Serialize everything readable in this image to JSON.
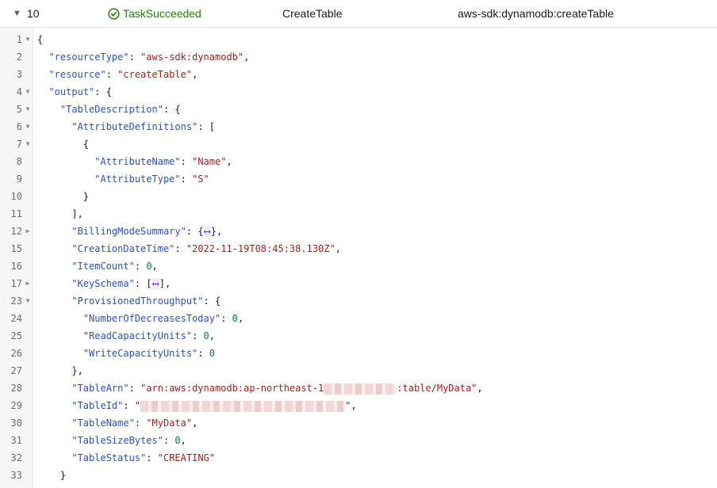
{
  "header": {
    "expand_glyph": "▼",
    "row_number": "10",
    "status_label": "TaskSucceeded",
    "status_color": "#1d8102",
    "step_name": "CreateTable",
    "resource": "aws-sdk:dynamodb:createTable"
  },
  "editor": {
    "lines": [
      {
        "num": "1",
        "fold": "open",
        "text": "{"
      },
      {
        "num": "2",
        "fold": "",
        "text": "  \"resourceType\": \"aws-sdk:dynamodb\","
      },
      {
        "num": "3",
        "fold": "",
        "text": "  \"resource\": \"createTable\","
      },
      {
        "num": "4",
        "fold": "open",
        "text": "  \"output\": {"
      },
      {
        "num": "5",
        "fold": "open",
        "text": "    \"TableDescription\": {"
      },
      {
        "num": "6",
        "fold": "open",
        "text": "      \"AttributeDefinitions\": ["
      },
      {
        "num": "7",
        "fold": "open",
        "text": "        {"
      },
      {
        "num": "8",
        "fold": "",
        "text": "          \"AttributeName\": \"Name\","
      },
      {
        "num": "9",
        "fold": "",
        "text": "          \"AttributeType\": \"S\""
      },
      {
        "num": "10",
        "fold": "",
        "text": "        }"
      },
      {
        "num": "11",
        "fold": "",
        "text": "      ],"
      },
      {
        "num": "12",
        "fold": "closed",
        "text": "      \"BillingModeSummary\": {⟷},"
      },
      {
        "num": "15",
        "fold": "",
        "text": "      \"CreationDateTime\": \"2022-11-19T08:45:38.130Z\","
      },
      {
        "num": "16",
        "fold": "",
        "text": "      \"ItemCount\": 0,"
      },
      {
        "num": "17",
        "fold": "closed",
        "text": "      \"KeySchema\": [⟷],"
      },
      {
        "num": "23",
        "fold": "open",
        "text": "      \"ProvisionedThroughput\": {"
      },
      {
        "num": "24",
        "fold": "",
        "text": "        \"NumberOfDecreasesToday\": 0,"
      },
      {
        "num": "25",
        "fold": "",
        "text": "        \"ReadCapacityUnits\": 0,"
      },
      {
        "num": "26",
        "fold": "",
        "text": "        \"WriteCapacityUnits\": 0"
      },
      {
        "num": "27",
        "fold": "",
        "text": "      },"
      },
      {
        "num": "28",
        "fold": "",
        "text": "      \"TableArn\": \"arn:aws:dynamodb:ap-northeast-1[REDACTED_ARN]:table/MyData\","
      },
      {
        "num": "29",
        "fold": "",
        "text": "      \"TableId\": \"[REDACTED_ID]\","
      },
      {
        "num": "30",
        "fold": "",
        "text": "      \"TableName\": \"MyData\","
      },
      {
        "num": "31",
        "fold": "",
        "text": "      \"TableSizeBytes\": 0,"
      },
      {
        "num": "32",
        "fold": "",
        "text": "      \"TableStatus\": \"CREATING\""
      },
      {
        "num": "33",
        "fold": "",
        "text": "    }"
      }
    ]
  }
}
